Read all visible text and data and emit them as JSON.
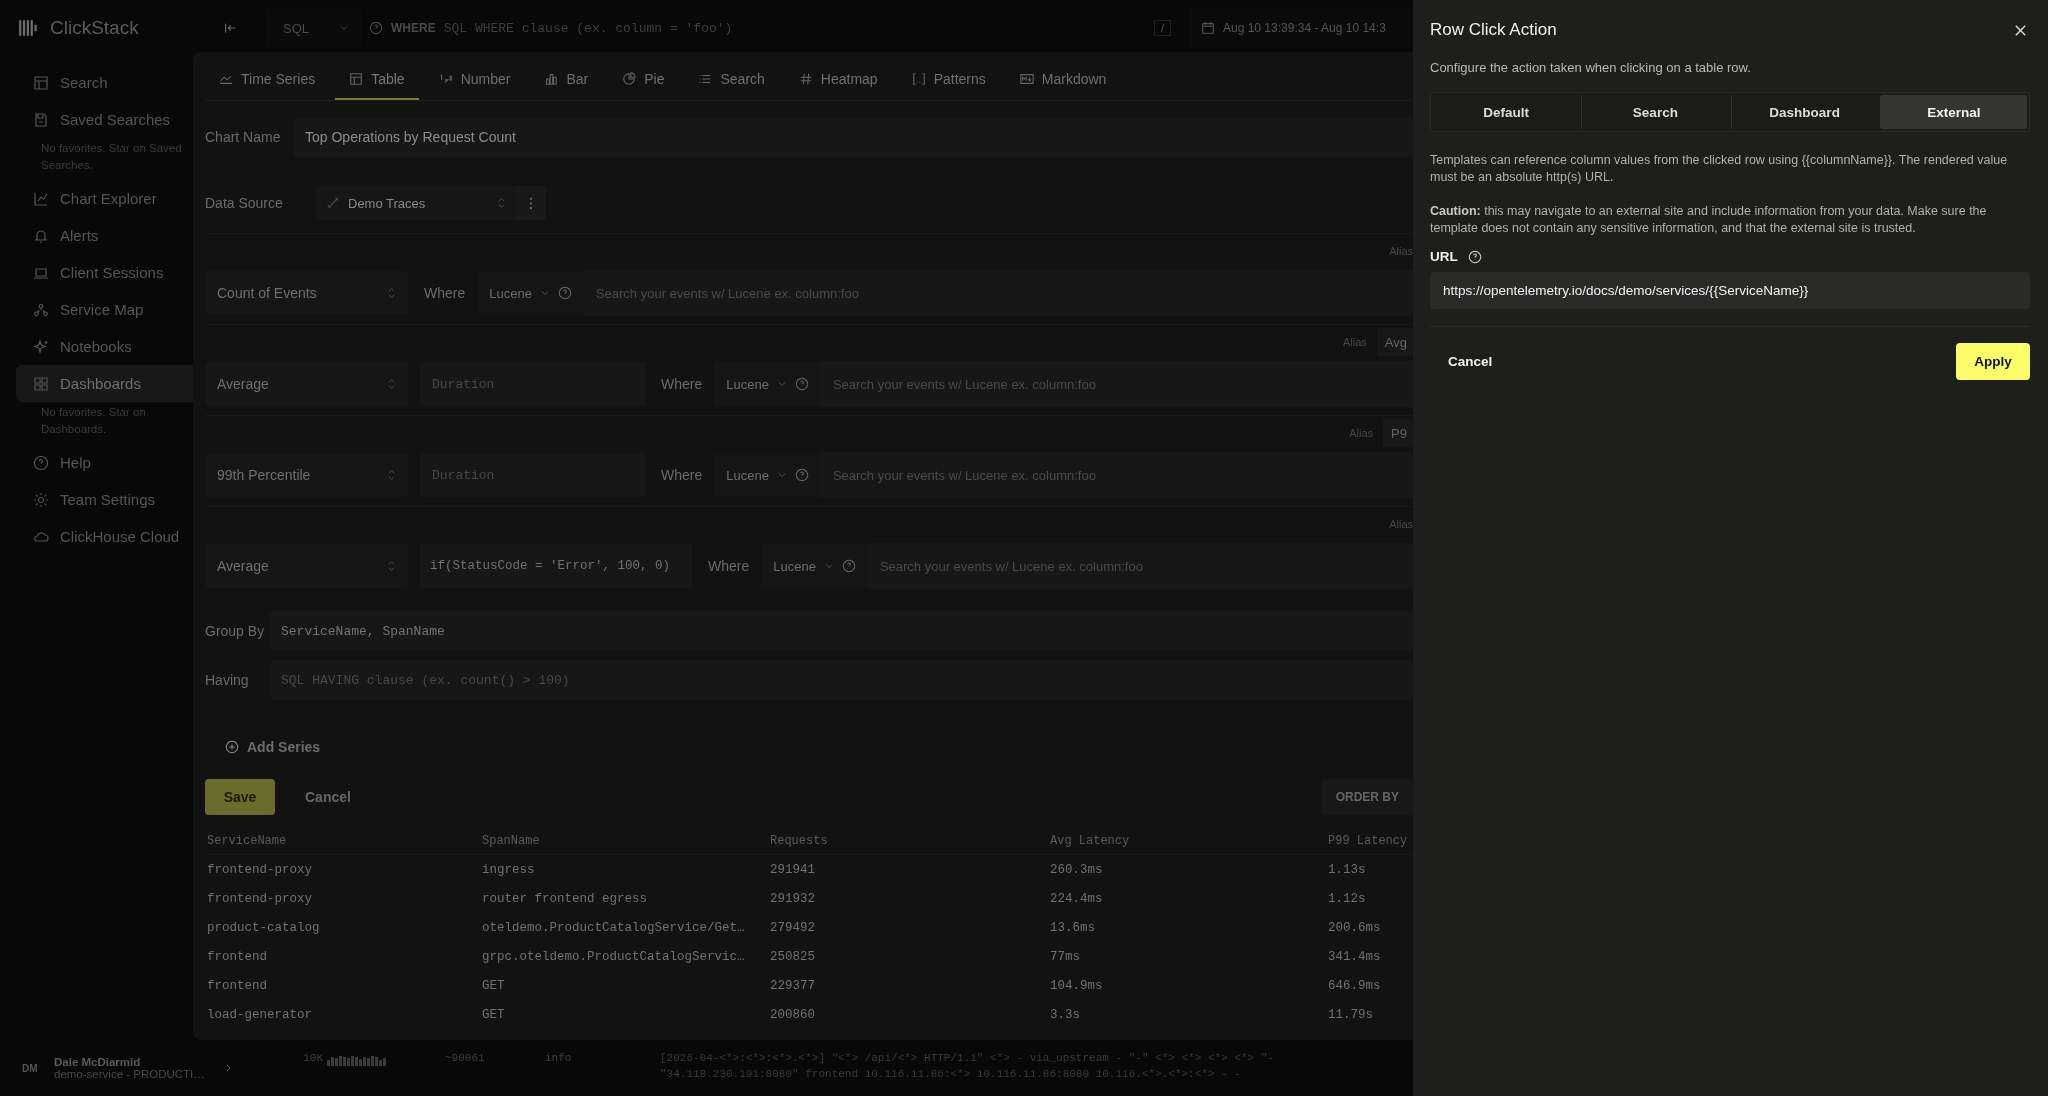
{
  "app": {
    "logo": "ClickStack"
  },
  "sidebar": {
    "items": [
      {
        "label": "Search",
        "selected": false
      },
      {
        "label": "Saved Searches",
        "selected": false,
        "hint": "No favorites. Star on Saved Searches."
      },
      {
        "label": "Chart Explorer",
        "selected": false
      },
      {
        "label": "Alerts",
        "selected": false
      },
      {
        "label": "Client Sessions",
        "selected": false
      },
      {
        "label": "Service Map",
        "selected": false
      },
      {
        "label": "Notebooks",
        "selected": false
      },
      {
        "label": "Dashboards",
        "selected": true,
        "hint": "No favorites. Star on Dashboards."
      },
      {
        "label": "Help",
        "selected": false
      },
      {
        "label": "Team Settings",
        "selected": false
      },
      {
        "label": "ClickHouse Cloud",
        "selected": false
      }
    ],
    "user": {
      "initials": "DM",
      "name": "Dale McDiarmid",
      "team": "demo-service - PRODUCTI…"
    }
  },
  "top_bar": {
    "language": "SQL",
    "where_label": "WHERE",
    "where_placeholder": "SQL WHERE clause (ex. column = 'foo')",
    "shortcut": "/",
    "time_range": "Aug 10 13:39:34 - Aug 10 14:3"
  },
  "log_row": {
    "count_label": "10K",
    "pattern_count": "~90061",
    "severity": "info",
    "lines": [
      "[2026-04-<*>:<*>:<*>.<*>] \"<*> /api/<*> HTTP/1.1\" <*> - via_upstream - \"-\" <*> <*> <*> <*> \"-",
      "\"34.118.230.191:8080\" frontend 10.116.11.86:<*> 10.116.11.86:8080 10.116.<*>.<*>:<*> - -"
    ]
  },
  "chart_editor": {
    "tabs": [
      {
        "label": "Time Series",
        "selected": false
      },
      {
        "label": "Table",
        "selected": true
      },
      {
        "label": "Number",
        "selected": false
      },
      {
        "label": "Bar",
        "selected": false
      },
      {
        "label": "Pie",
        "selected": false
      },
      {
        "label": "Search",
        "selected": false
      },
      {
        "label": "Heatmap",
        "selected": false
      },
      {
        "label": "Patterns",
        "selected": false
      },
      {
        "label": "Markdown",
        "selected": false
      }
    ],
    "chart_name": {
      "label": "Chart Name",
      "value": "Top Operations by Request Count"
    },
    "data_source": {
      "label": "Data Source",
      "value": "Demo Traces"
    },
    "series": [
      {
        "alias_label": "Alias",
        "aggregation": "Count of Events",
        "where_label": "Where",
        "language": "Lucene",
        "where_placeholder": "Search your events w/ Lucene ex. column:foo"
      },
      {
        "alias_label": "Alias",
        "alias_value": "Avg",
        "aggregation": "Average",
        "field_placeholder": "Duration",
        "where_label": "Where",
        "language": "Lucene",
        "where_placeholder": "Search your events w/ Lucene ex. column:foo"
      },
      {
        "alias_label": "Alias",
        "alias_value": "P9",
        "aggregation": "99th Percentile",
        "field_placeholder": "Duration",
        "where_label": "Where",
        "language": "Lucene",
        "where_placeholder": "Search your events w/ Lucene ex. column:foo"
      },
      {
        "alias_label": "Alias",
        "aggregation": "Average",
        "field_value": "if(StatusCode = 'Error', 100, 0)",
        "where_label": "Where",
        "language": "Lucene",
        "where_placeholder": "Search your events w/ Lucene ex. column:foo"
      }
    ],
    "group_by": {
      "label": "Group By",
      "value": "ServiceName, SpanName"
    },
    "having": {
      "label": "Having",
      "placeholder": "SQL HAVING clause (ex. count() > 100)"
    },
    "add_series": "Add Series",
    "save": "Save",
    "cancel": "Cancel",
    "order_by": "ORDER BY",
    "table": {
      "columns": [
        "ServiceName",
        "SpanName",
        "Requests",
        "Avg Latency",
        "P99 Latency"
      ],
      "rows": [
        [
          "frontend-proxy",
          "ingress",
          "291941",
          "260.3ms",
          "1.13s"
        ],
        [
          "frontend-proxy",
          "router frontend egress",
          "291932",
          "224.4ms",
          "1.12s"
        ],
        [
          "product-catalog",
          "oteldemo.ProductCatalogService/Get…",
          "279492",
          "13.6ms",
          "200.6ms"
        ],
        [
          "frontend",
          "grpc.oteldemo.ProductCatalogServic…",
          "250825",
          "77ms",
          "341.4ms"
        ],
        [
          "frontend",
          "GET",
          "229377",
          "104.9ms",
          "646.9ms"
        ],
        [
          "load-generator",
          "GET",
          "200860",
          "3.3s",
          "11.79s"
        ]
      ]
    }
  },
  "drawer": {
    "title": "Row Click Action",
    "description": "Configure the action taken when clicking on a table row.",
    "tabs": [
      {
        "label": "Default",
        "selected": false
      },
      {
        "label": "Search",
        "selected": false
      },
      {
        "label": "Dashboard",
        "selected": false
      },
      {
        "label": "External",
        "selected": true
      }
    ],
    "help_text": "Templates can reference column values from the clicked row using {{columnName}}. The rendered value must be an absolute http(s) URL.",
    "caution": "**Caution:** this may navigate to an external site and include information from your data. Make sure the template does not contain any sensitive information, and that the external site is trusted.",
    "url": {
      "label": "URL",
      "value": "https://opentelemetry.io/docs/demo/services/{{ServiceName}}"
    },
    "cancel": "Cancel",
    "apply": "Apply"
  }
}
